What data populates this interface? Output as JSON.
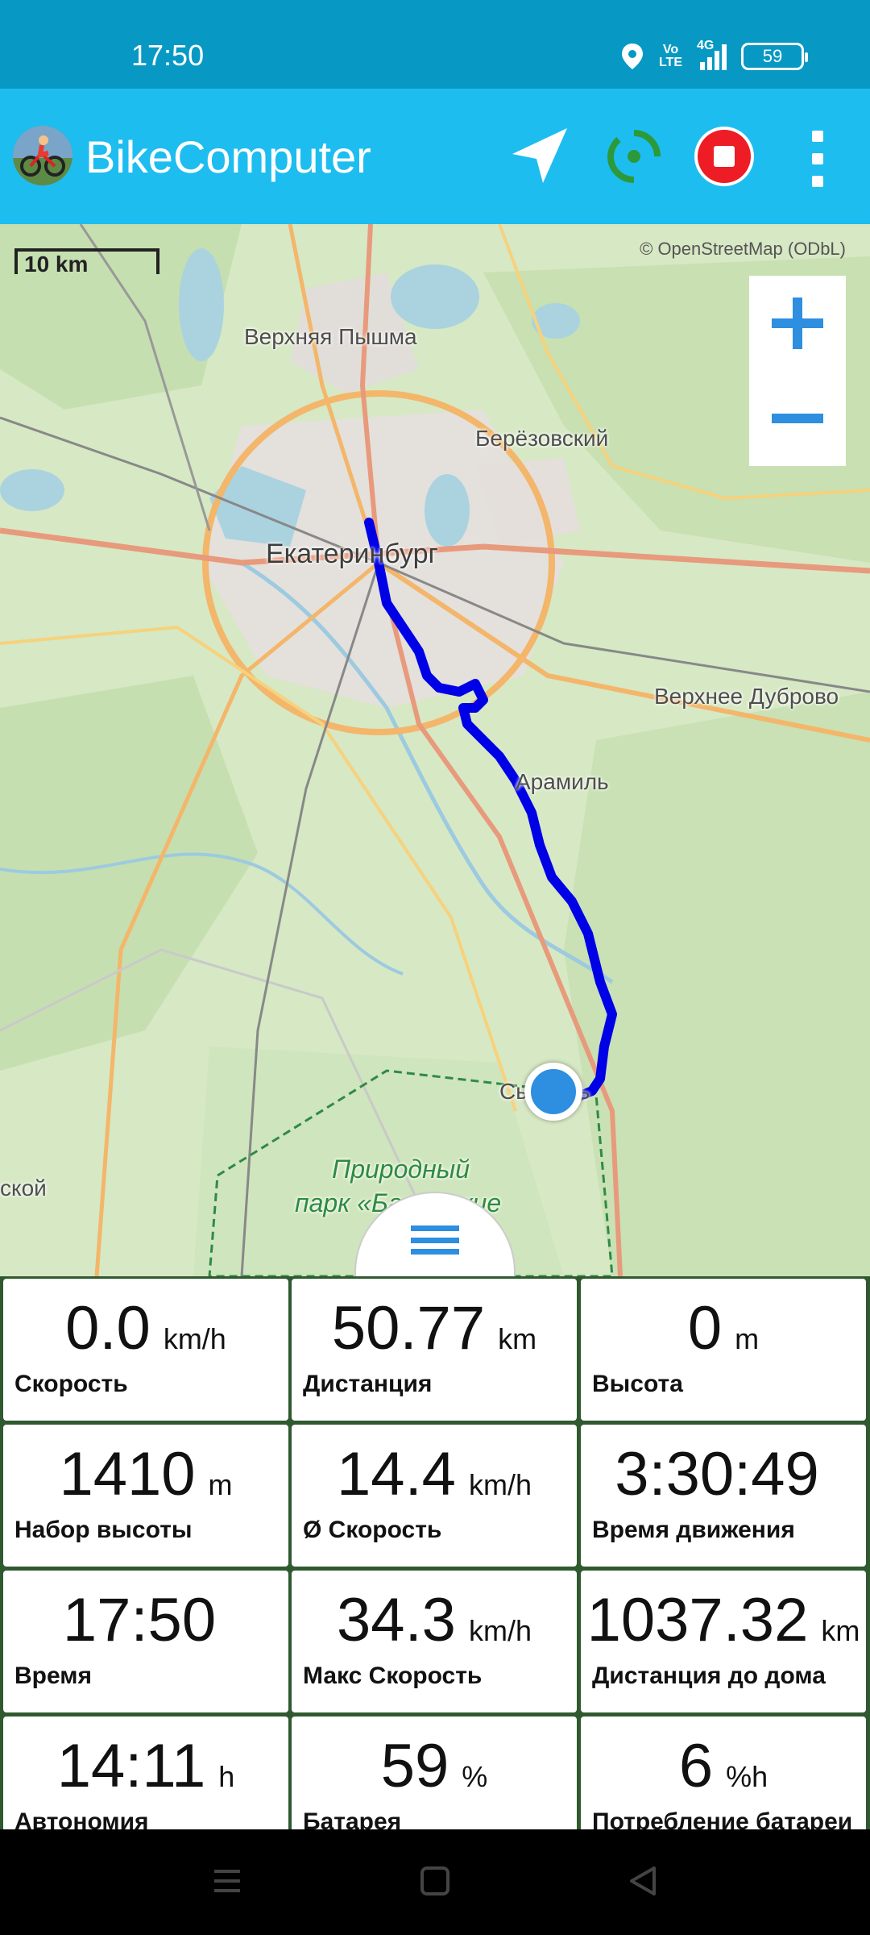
{
  "status_bar": {
    "time": "17:50",
    "network_label_1": "Vo",
    "network_label_2": "LTE",
    "signal_label": "4G",
    "battery": "59"
  },
  "app_bar": {
    "title": "BikeComputer",
    "icons": [
      "navigation-arrow-icon",
      "gps-status-icon",
      "stop-recording-icon",
      "overflow-menu-icon"
    ]
  },
  "map": {
    "attribution": "© OpenStreetMap (ODbL)",
    "scale_label": "10 km",
    "labels": {
      "verkhnyaya_pyshma": "Верхняя Пышма",
      "berezovsky": "Берёзовский",
      "yekaterinburg": "Екатеринбург",
      "verkhnee_dubrovo": "Верхнее Дуброво",
      "aramil": "Арамиль",
      "sysert": "Сысерть",
      "park_line1": "Природный",
      "park_line2": "парк «Бажовские",
      "left_edge": "ской"
    },
    "zoom_in_icon": "plus-icon",
    "zoom_out_icon": "minus-icon",
    "route_color": "#0000e6",
    "position_color": "#2e8ee0"
  },
  "tiles": [
    {
      "value": "0.0",
      "unit": "km/h",
      "label": "Скорость"
    },
    {
      "value": "50.77",
      "unit": "km",
      "label": "Дистанция"
    },
    {
      "value": "0",
      "unit": "m",
      "label": "Высота"
    },
    {
      "value": "1410",
      "unit": "m",
      "label": "Набор высоты"
    },
    {
      "value": "14.4",
      "unit": "km/h",
      "label": "Ø Скорость"
    },
    {
      "value": "3:30:49",
      "unit": "",
      "label": "Время движения"
    },
    {
      "value": "17:50",
      "unit": "",
      "label": "Время"
    },
    {
      "value": "34.3",
      "unit": "km/h",
      "label": "Макс Скорость"
    },
    {
      "value": "1037.32",
      "unit": "km",
      "label": "Дистанция до дома"
    },
    {
      "value": "14:11",
      "unit": "h",
      "label": "Автономия"
    },
    {
      "value": "59",
      "unit": "%",
      "label": "Батарея"
    },
    {
      "value": "6",
      "unit": "%h",
      "label": "Потребление батареи"
    }
  ],
  "navbar": {
    "icons": [
      "recent-apps-icon",
      "home-icon",
      "back-icon"
    ]
  }
}
